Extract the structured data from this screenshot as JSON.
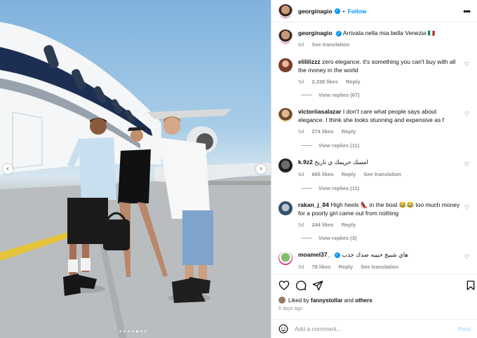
{
  "post": {
    "username": "georginagio",
    "follow_label": "Follow",
    "caption": "Arrivata nella mia bella Venezia 🇮🇹",
    "caption_age": "6d",
    "see_translation": "See translation"
  },
  "comments": [
    {
      "user": "elililizzz",
      "text": "zero elegance. it's something you can't buy with all the money in the world",
      "age": "5d",
      "likes": "2,338 likes",
      "reply": "Reply",
      "view_replies": "View replies (67)"
    },
    {
      "user": "victoriiasalazar",
      "text": "I don't care what people says about elegance. I think she looks stunning and expensive as f",
      "age": "5d",
      "likes": "274 likes",
      "reply": "Reply",
      "view_replies": "View replies (11)"
    },
    {
      "user": "k.9z2",
      "text": "امسك حريمك ي تاريخ",
      "age": "6d",
      "likes": "665 likes",
      "reply": "Reply",
      "see_translation": "See translation",
      "view_replies": "View replies (11)"
    },
    {
      "user": "rakan_j_84",
      "text": "High heels 👠 in the boat 😂😂 too much money for a poorly girl came out from nothing",
      "age": "5d",
      "likes": "244 likes",
      "reply": "Reply",
      "view_replies": "View replies (3)"
    },
    {
      "user": "moamel37_",
      "text": "هاي شبيج حبيبه صدك جذب",
      "age": "5d",
      "likes": "78 likes",
      "reply": "Reply",
      "see_translation": "See translation"
    }
  ],
  "likes_bar": {
    "prefix": "Liked by",
    "liker": "fannystollar",
    "and": "and",
    "others": "others",
    "time": "6 days ago"
  },
  "comment_box": {
    "placeholder": "Add a comment...",
    "post_label": "Post"
  },
  "colors": {
    "accent": "#0095f6",
    "muted": "#8e8e8e"
  },
  "icons": [
    "more-options-icon",
    "heart-icon",
    "comment-icon",
    "share-icon",
    "bookmark-icon",
    "emoji-icon",
    "chevron-left-icon",
    "chevron-right-icon",
    "verified-icon"
  ],
  "carousel": {
    "slides": 7,
    "active": 5
  }
}
